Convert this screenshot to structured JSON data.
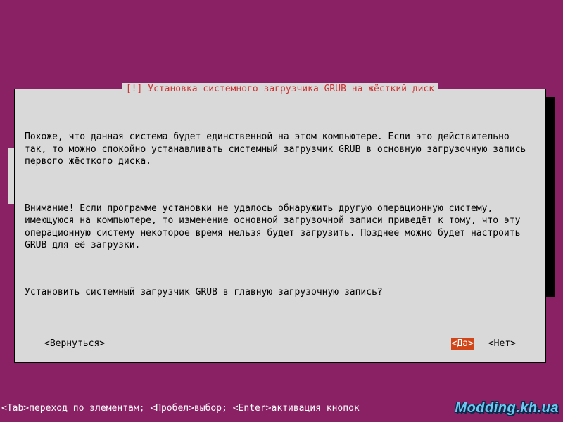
{
  "dialog": {
    "title": "[!] Установка системного загрузчика GRUB на жёсткий диск",
    "para1": "Похоже, что данная система будет единственной на этом компьютере. Если это действительно так, то можно спокойно устанавливать системный загрузчик GRUB в основную загрузочную запись первого жёсткого диска.",
    "para2": "Внимание! Если программе установки не удалось обнаружить другую операционную систему, имеющуюся на компьютере, то изменение основной загрузочной записи приведёт к тому, что эту операционную систему некоторое время нельзя будет загрузить. Позднее можно будет настроить GRUB для её загрузки.",
    "para3": "Установить системный загрузчик GRUB в главную загрузочную запись?",
    "back_label": "<Вернуться>",
    "yes_label": "<Да>",
    "no_label": "<Нет>"
  },
  "footer": {
    "help": "<Tab>переход по элементам; <Пробел>выбор; <Enter>активация кнопок"
  },
  "watermark": "Modding.kh.ua"
}
